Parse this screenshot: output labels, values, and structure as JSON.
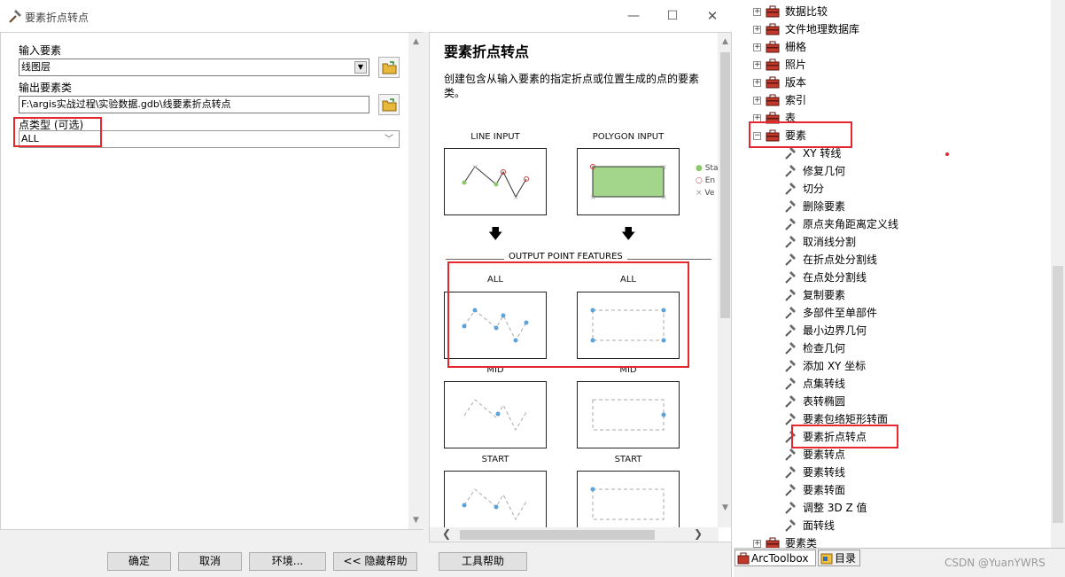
{
  "window": {
    "title": "要素折点转点"
  },
  "params": {
    "input_label": "输入要素",
    "input_value": "线图层",
    "output_label": "输出要素类",
    "output_value": "F:\\argis实战过程\\实验数据.gdb\\线要素折点转点",
    "type_label": "点类型 (可选)",
    "type_value": "ALL"
  },
  "help": {
    "title": "要素折点转点",
    "description": "创建包含从输入要素的指定折点或位置生成的点的要素类。",
    "line_input": "LINE INPUT",
    "polygon_input": "POLYGON INPUT",
    "legend": [
      "Sta",
      "En",
      "Ve"
    ],
    "output_header": "OUTPUT POINT FEATURES",
    "rows": [
      {
        "left": "ALL",
        "right": "ALL"
      },
      {
        "left": "MID",
        "right": "MID"
      },
      {
        "left": "START",
        "right": "START"
      }
    ]
  },
  "buttons": {
    "ok": "确定",
    "cancel": "取消",
    "env": "环境...",
    "hide_help": "<< 隐藏帮助",
    "tool_help": "工具帮助"
  },
  "tree": {
    "toolsets": [
      "数据比较",
      "文件地理数据库",
      "栅格",
      "照片",
      "版本",
      "索引",
      "表"
    ],
    "expanded_toolset": "要素",
    "tools": [
      "XY 转线",
      "修复几何",
      "切分",
      "删除要素",
      "原点夹角距离定义线",
      "取消线分割",
      "在折点处分割线",
      "在点处分割线",
      "复制要素",
      "多部件至单部件",
      "最小边界几何",
      "检查几何",
      "添加 XY 坐标",
      "点集转线",
      "表转椭圆",
      "要素包络矩形转面",
      "要素折点转点",
      "要素转点",
      "要素转线",
      "要素转面",
      "调整 3D Z 值",
      "面转线"
    ],
    "next_toolset": "要素类"
  },
  "tabs": {
    "arctoolbox": "ArcToolbox",
    "catalog": "目录"
  },
  "watermark": "CSDN @YuanYWRS",
  "colors": {
    "highlight_red": "#e8262d",
    "point_blue": "#5ba3d8",
    "polygon_fill": "#a3d68a"
  }
}
